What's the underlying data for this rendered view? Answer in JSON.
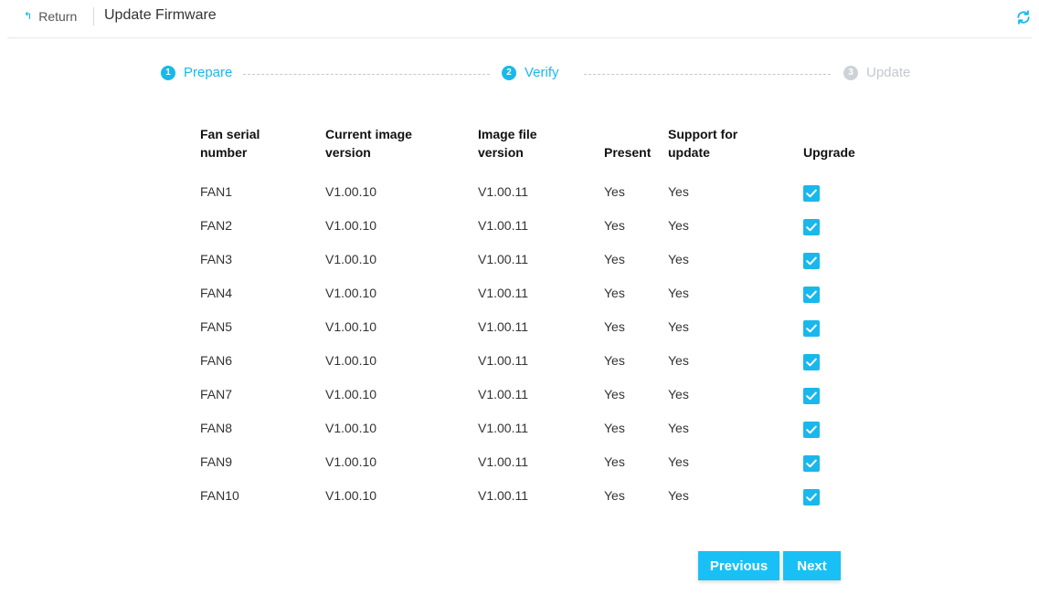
{
  "header": {
    "return_label": "Return",
    "title": "Update Firmware",
    "icons": {
      "return": "return-arrow-icon",
      "refresh": "refresh-icon"
    }
  },
  "steps": [
    {
      "number": "1",
      "label": "Prepare",
      "state": "active"
    },
    {
      "number": "2",
      "label": "Verify",
      "state": "active"
    },
    {
      "number": "3",
      "label": "Update",
      "state": "inactive"
    }
  ],
  "table": {
    "headers": [
      "Fan serial number",
      "Current image version",
      "Image file version",
      "Present",
      "Support for update",
      "Upgrade"
    ],
    "rows": [
      {
        "serial": "FAN1",
        "current": "V1.00.10",
        "file": "V1.00.11",
        "present": "Yes",
        "support": "Yes",
        "upgrade": true
      },
      {
        "serial": "FAN2",
        "current": "V1.00.10",
        "file": "V1.00.11",
        "present": "Yes",
        "support": "Yes",
        "upgrade": true
      },
      {
        "serial": "FAN3",
        "current": "V1.00.10",
        "file": "V1.00.11",
        "present": "Yes",
        "support": "Yes",
        "upgrade": true
      },
      {
        "serial": "FAN4",
        "current": "V1.00.10",
        "file": "V1.00.11",
        "present": "Yes",
        "support": "Yes",
        "upgrade": true
      },
      {
        "serial": "FAN5",
        "current": "V1.00.10",
        "file": "V1.00.11",
        "present": "Yes",
        "support": "Yes",
        "upgrade": true
      },
      {
        "serial": "FAN6",
        "current": "V1.00.10",
        "file": "V1.00.11",
        "present": "Yes",
        "support": "Yes",
        "upgrade": true
      },
      {
        "serial": "FAN7",
        "current": "V1.00.10",
        "file": "V1.00.11",
        "present": "Yes",
        "support": "Yes",
        "upgrade": true
      },
      {
        "serial": "FAN8",
        "current": "V1.00.10",
        "file": "V1.00.11",
        "present": "Yes",
        "support": "Yes",
        "upgrade": true
      },
      {
        "serial": "FAN9",
        "current": "V1.00.10",
        "file": "V1.00.11",
        "present": "Yes",
        "support": "Yes",
        "upgrade": true
      },
      {
        "serial": "FAN10",
        "current": "V1.00.10",
        "file": "V1.00.11",
        "present": "Yes",
        "support": "Yes",
        "upgrade": true
      }
    ]
  },
  "buttons": {
    "previous": "Previous",
    "next": "Next"
  },
  "colors": {
    "accent": "#19b8ec",
    "button": "#19c0f5",
    "inactive": "#c3c8cf"
  }
}
